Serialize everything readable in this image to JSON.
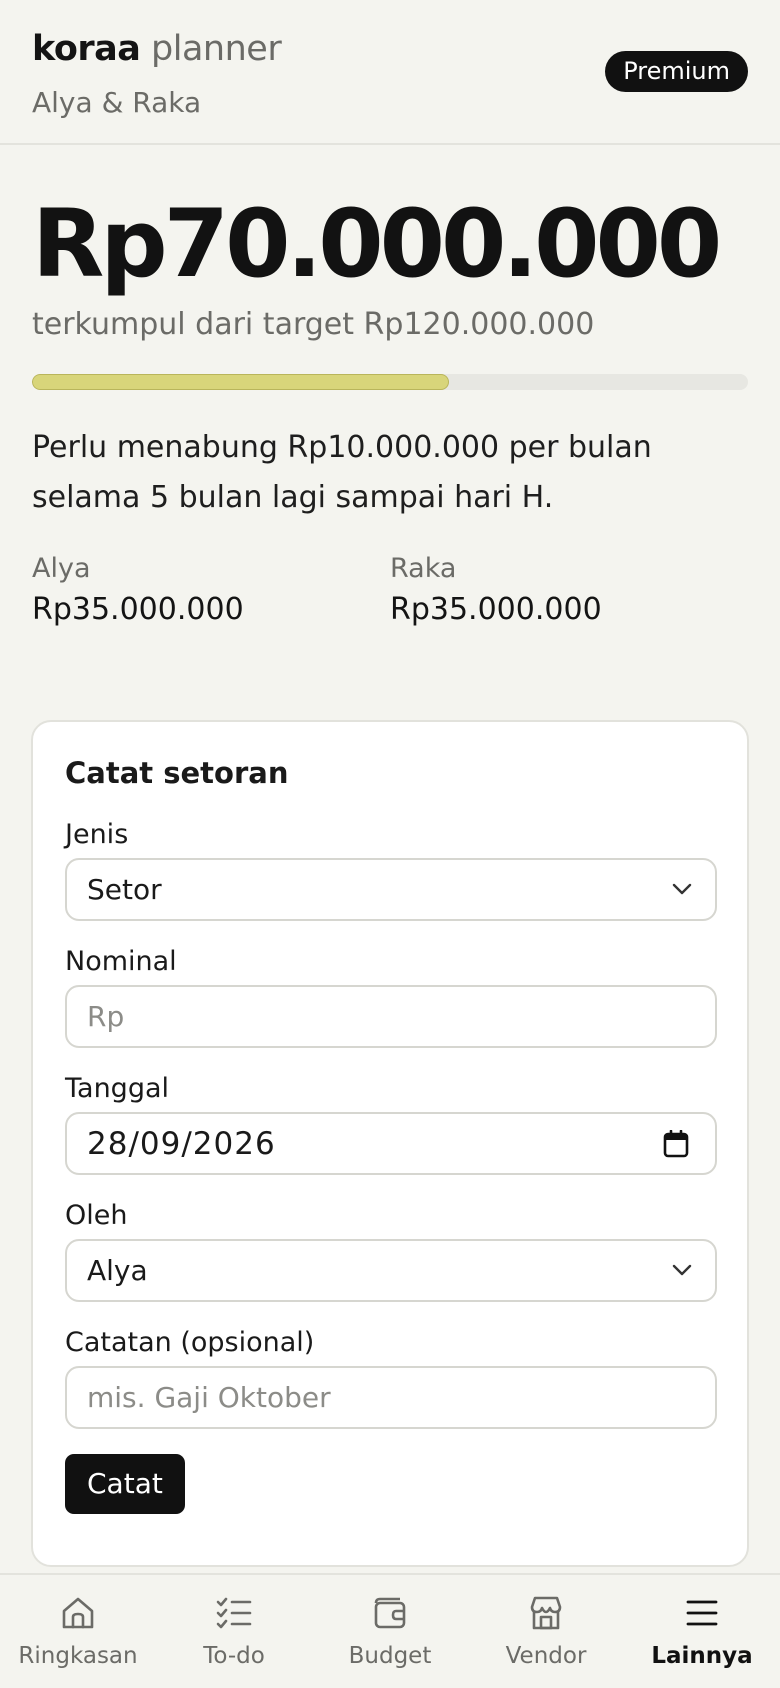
{
  "header": {
    "brand_bold": "koraa",
    "brand_light": "planner",
    "couple": "Alya & Raka",
    "premium_badge": "Premium"
  },
  "summary": {
    "collected": "Rp70.000.000",
    "target_text": "terkumpul dari target Rp120.000.000",
    "progress_fraction": 0.583,
    "saving_note": "Perlu menabung Rp10.000.000 per bulan selama 5 bulan lagi sampai hari H.",
    "contributors": [
      {
        "name": "Alya",
        "amount": "Rp35.000.000"
      },
      {
        "name": "Raka",
        "amount": "Rp35.000.000"
      }
    ]
  },
  "form": {
    "title": "Catat setoran",
    "type_label": "Jenis",
    "type_value": "Setor",
    "amount_label": "Nominal",
    "amount_placeholder": "Rp",
    "date_label": "Tanggal",
    "date_value": "28/09/2026",
    "by_label": "Oleh",
    "by_value": "Alya",
    "note_label": "Catatan (opsional)",
    "note_placeholder": "mis. Gaji Oktober",
    "submit_label": "Catat"
  },
  "nav": {
    "items": [
      {
        "label": "Ringkasan",
        "icon": "home-icon"
      },
      {
        "label": "To-do",
        "icon": "checklist-icon"
      },
      {
        "label": "Budget",
        "icon": "wallet-icon"
      },
      {
        "label": "Vendor",
        "icon": "store-icon"
      },
      {
        "label": "Lainnya",
        "icon": "menu-icon",
        "active": true
      }
    ]
  },
  "colors": {
    "background": "#f4f4ef",
    "progress_fill": "#d8d57a",
    "dark": "#111111",
    "muted": "#6b6b67"
  }
}
